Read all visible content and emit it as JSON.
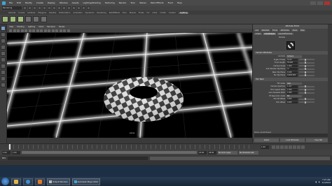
{
  "app": {
    "menu": [
      "File",
      "Edit",
      "Modify",
      "Create",
      "Display",
      "Window",
      "Assets",
      "Lighting/Shading",
      "Texturing",
      "Render",
      "Toon",
      "Stereo",
      "Paint Effects",
      "Fluid",
      "Help"
    ]
  },
  "statusline": {
    "mode_select": "Rendering"
  },
  "shelf": {
    "tabs": [
      "General",
      "Curves",
      "Surfaces",
      "Polygons",
      "Subdivs",
      "Deformation",
      "Animation",
      "Dynamics",
      "Rendering",
      "PaintEffects",
      "Toon",
      "Muscle",
      "Fluids",
      "Fur",
      "nHair",
      "nCloth",
      "Custom",
      "Lighting"
    ],
    "active_tab": "Lighting"
  },
  "viewport": {
    "menu": [
      "View",
      "Shading",
      "Lighting",
      "Show",
      "Renderer",
      "Panels"
    ],
    "camera_label": "persp"
  },
  "attribute_editor": {
    "title": "Attribute Editor",
    "tabs": [
      "List",
      "Selected",
      "Focus",
      "Attributes",
      "Show",
      "Help"
    ],
    "node_tabs": [
      "ramp1",
      "rampShape1",
      "place2dTexture1"
    ],
    "sample_label": "Sample",
    "sections": {
      "camera": "Camera Attributes",
      "film_back": "Film Back"
    },
    "camera_rows": [
      {
        "label": "Controls",
        "type": "dd",
        "value": "Camera"
      },
      {
        "label": "Angle of View",
        "type": "fld",
        "value": "54.43"
      },
      {
        "label": "Focal Length",
        "type": "fld",
        "value": "35.000"
      },
      {
        "label": "Camera Scale",
        "type": "fld",
        "value": "1.000"
      },
      {
        "label": "Auto Render Clip Plane",
        "type": "fld",
        "value": "on"
      },
      {
        "label": "Near Clip Plane",
        "type": "fld",
        "value": "0.100"
      },
      {
        "label": "Far Clip Plane",
        "type": "fld",
        "value": "10000.000"
      }
    ],
    "film_rows": [
      {
        "label": "Film Gate",
        "type": "dd",
        "value": "User"
      },
      {
        "label": "Camera Aperture",
        "type": "fld",
        "value": "1.417"
      },
      {
        "label": "Film Aspect Ratio",
        "type": "fld",
        "value": "1.500"
      },
      {
        "label": "Lens Squeeze Ratio",
        "type": "fld",
        "value": "1.000"
      },
      {
        "label": "Fit Resolution Gate",
        "type": "dd",
        "value": "Fill"
      },
      {
        "label": "Film Fit Offset",
        "type": "fld",
        "value": "0.000"
      },
      {
        "label": "Film Offset",
        "type": "fld",
        "value": "0.000"
      }
    ],
    "notes_label": "Notes: perspShape1",
    "buttons": [
      "Select",
      "Load Attributes",
      "Copy Tab"
    ]
  },
  "timeline": {
    "current_frame": "1.00",
    "range_start": "1.00",
    "range_end": "24.00",
    "anim_start": "1.00",
    "anim_end": "48.00",
    "anim_layer_label": "No Anim Layer",
    "char_set_label": "No Character Set"
  },
  "cmdline": {
    "lang": "MEL"
  },
  "taskbar": {
    "windows": [
      "Output Window",
      "Autodesk Maya 2012"
    ],
    "clock_time": "7:27 AM",
    "clock_date": "1/1/2012"
  }
}
